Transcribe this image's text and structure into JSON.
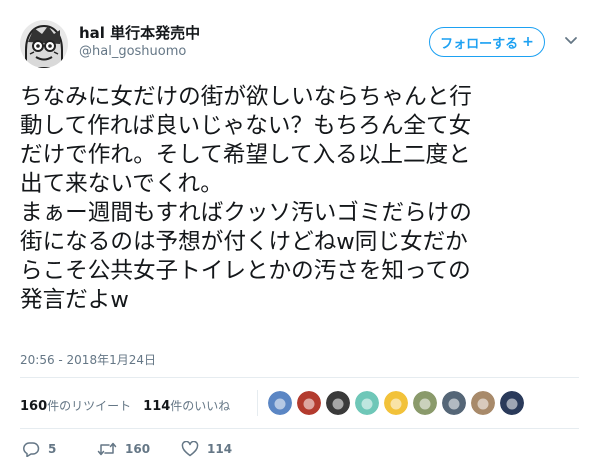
{
  "author": {
    "display_name": "hal 単行本発売中",
    "handle": "@hal_goshuomo"
  },
  "follow_button": {
    "label": "フォローする",
    "plus": "+"
  },
  "tweet": {
    "lines": [
      "ちなみに女だけの街が欲しいならちゃんと行",
      "動して作れば良いじゃない？もちろん全て女",
      "だけで作れ。そして希望して入る以上二度と",
      "出て来ないでくれ。",
      "まぁー週間もすればクッソ汚いゴミだらけの",
      "街になるのは予想が付くけどねw同じ女だか",
      "らこそ公共女子トイレとかの汚さを知っての",
      "発言だよw"
    ],
    "timestamp": "20:56 - 2018年1月24日"
  },
  "stats": {
    "retweet_count": "160",
    "retweet_label": "件のリツイート",
    "like_count": "114",
    "like_label": "件のいいね"
  },
  "liker_avatars": [
    {
      "name": "liker-1",
      "color": "#5b86c4"
    },
    {
      "name": "liker-2",
      "color": "#b33b2e"
    },
    {
      "name": "liker-3",
      "color": "#3a3a3a"
    },
    {
      "name": "liker-4",
      "color": "#6fc7b8"
    },
    {
      "name": "liker-5",
      "color": "#f2c23a"
    },
    {
      "name": "liker-6",
      "color": "#8a9a6b"
    },
    {
      "name": "liker-7",
      "color": "#556677"
    },
    {
      "name": "liker-8",
      "color": "#a88a6a"
    },
    {
      "name": "liker-9",
      "color": "#2a3a5a"
    }
  ],
  "actions": {
    "reply_count": "5",
    "retweet_count": "160",
    "like_count": "114"
  },
  "colors": {
    "accent": "#1da1f2",
    "secondary_text": "#657786",
    "primary_text": "#14171a"
  }
}
